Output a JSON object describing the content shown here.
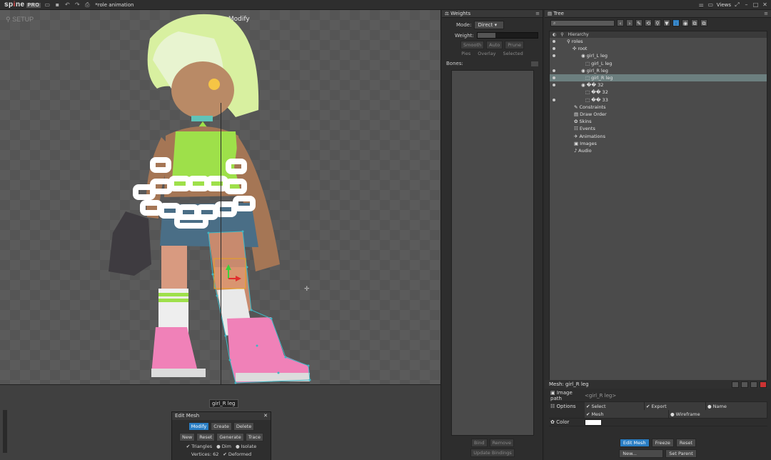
{
  "app": {
    "logo": "sp",
    "logo_accent": "i",
    "logo_rest": "ne",
    "pro": "PRO",
    "project": "*role animation",
    "views": "Views"
  },
  "viewport": {
    "mode": "SETUP",
    "edit_title": "Edit Mesh: Modify",
    "bone_tag": "girl_R leg"
  },
  "edit_mesh": {
    "title": "Edit Mesh",
    "row1": [
      "Modify",
      "Create",
      "Delete"
    ],
    "row2": [
      "New",
      "Reset",
      "Generate",
      "Trace"
    ],
    "triangles": "Triangles",
    "dim": "Dim",
    "isolate": "Isolate",
    "vertices": "Vertices: 62",
    "deformed": "Deformed"
  },
  "weights": {
    "tab": "Weights",
    "mode_label": "Mode:",
    "mode_value": "Direct",
    "weight_label": "Weight:",
    "weight_level": 0.3,
    "buttons": [
      "Smooth",
      "Auto",
      "Prune"
    ],
    "subtabs": [
      "Pies",
      "Overlay",
      "Selected"
    ],
    "bones_label": "Bones:",
    "bind": "Bind",
    "remove": "Remove",
    "update": "Update Bindings"
  },
  "tree": {
    "tab": "Tree",
    "hierarchy": "Hierarchy",
    "rows": [
      {
        "label": "roles",
        "indent": 24,
        "icon": "⚲",
        "eye": true
      },
      {
        "label": "root",
        "indent": 32,
        "icon": "✣",
        "eye": true
      },
      {
        "label": "girl_L leg",
        "indent": 44,
        "icon": "◉",
        "eye": true
      },
      {
        "label": "girl_L leg",
        "indent": 50,
        "icon": "⬚",
        "eye": false
      },
      {
        "label": "girl_R leg",
        "indent": 44,
        "icon": "◉",
        "eye": true
      },
      {
        "label": "girl_R leg",
        "indent": 50,
        "icon": "⬚",
        "eye": true,
        "selected": true
      },
      {
        "label": "�� 32",
        "indent": 44,
        "icon": "◉",
        "eye": true
      },
      {
        "label": "�� 32",
        "indent": 50,
        "icon": "⬚",
        "eye": false
      },
      {
        "label": "�� 33",
        "indent": 50,
        "icon": "⬚",
        "eye": true
      },
      {
        "label": "Constraints",
        "indent": 34,
        "icon": "✎",
        "eye": false
      },
      {
        "label": "Draw Order",
        "indent": 34,
        "icon": "▤",
        "eye": false
      },
      {
        "label": "Skins",
        "indent": 34,
        "icon": "✿",
        "eye": false
      },
      {
        "label": "Events",
        "indent": 34,
        "icon": "☷",
        "eye": false
      },
      {
        "label": "Animations",
        "indent": 34,
        "icon": "✈",
        "eye": false
      },
      {
        "label": "Images",
        "indent": 34,
        "icon": "▣",
        "eye": false
      },
      {
        "label": "Audio",
        "indent": 34,
        "icon": "♪",
        "eye": false
      }
    ]
  },
  "mesh": {
    "title": "Mesh: girl_R leg",
    "image_path_label": "Image path",
    "image_path_value": "<girl_R leg>",
    "options_label": "Options",
    "select": "Select",
    "export": "Export",
    "name": "Name",
    "mesh": "Mesh",
    "wireframe": "Wireframe",
    "color_label": "Color",
    "btn_edit": "Edit Mesh",
    "btn_freeze": "Freeze",
    "btn_reset": "Reset",
    "btn_new": "New...",
    "btn_parent": "Set Parent"
  },
  "colors": {
    "accent": "#2a7ec4",
    "selection": "#6c7f7f",
    "mesh_wire": "#3fb7c4",
    "hair": "#d8f0a0",
    "top": "#9ee04a",
    "skin": "#b98a66",
    "skirt": "#4a6e86",
    "shoe": "#f081b8",
    "chain": "#ffffff"
  }
}
